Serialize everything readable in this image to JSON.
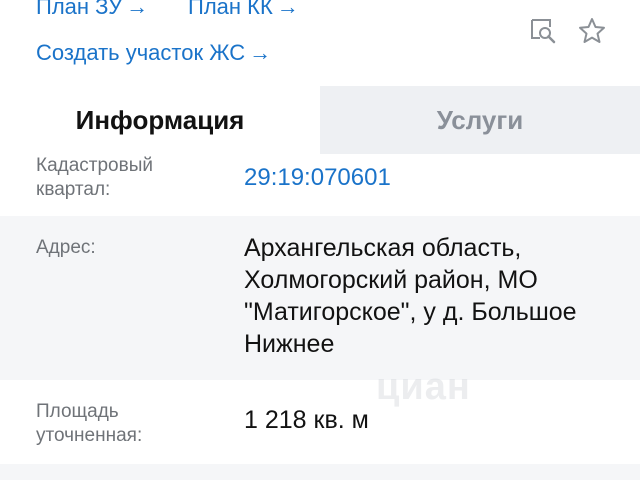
{
  "links": {
    "plan_zu": "План ЗУ",
    "plan_kk": "План КК",
    "create_plot": "Создать участок ЖС",
    "arrow": "→"
  },
  "icons": {
    "map_search": "map-search-icon",
    "favorite": "star-outline-icon"
  },
  "tabs": [
    {
      "label": "Информация",
      "active": true
    },
    {
      "label": "Услуги",
      "active": false
    }
  ],
  "details": {
    "kvartal": {
      "label": "Кадастровый квартал:",
      "value": "29:19:070601"
    },
    "address": {
      "label": "Адрес:",
      "value": "Архангельская область, Холмогорский район, МО \"Матигорское\", у д. Большое Нижнее"
    },
    "area": {
      "label": "Площадь уточненная:",
      "value": "1 218 кв. м"
    }
  },
  "watermark": "циан",
  "colors": {
    "link": "#1a73c9",
    "label": "#6f7378",
    "tab_inactive_bg": "#eef0f3",
    "row_alt_bg": "#f5f6f8"
  }
}
